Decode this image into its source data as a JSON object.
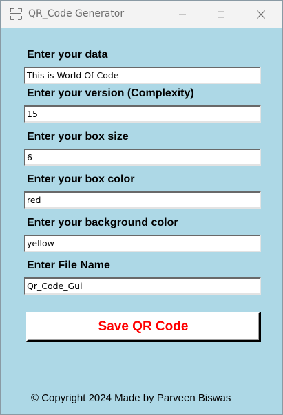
{
  "window": {
    "title": "QR_Code Generator"
  },
  "form": {
    "fields": [
      {
        "label": "Enter your data",
        "value": "This is World Of Code"
      },
      {
        "label": "Enter your version (Complexity)",
        "value": "15"
      },
      {
        "label": "Enter your box size",
        "value": "6"
      },
      {
        "label": "Enter your box color",
        "value": "red"
      },
      {
        "label": "Enter your background color",
        "value": "yellow"
      },
      {
        "label": "Enter File Name",
        "value": "Qr_Code_Gui"
      }
    ],
    "save_label": "Save QR Code"
  },
  "footer": {
    "text": "© Copyright 2024 Made by Parveen Biswas"
  },
  "colors": {
    "background": "#add8e6",
    "save_text": "#ff0000"
  },
  "icons": {
    "app": "qr-scan-icon",
    "minimize": "minimize-icon",
    "maximize": "maximize-icon",
    "close": "close-icon"
  }
}
